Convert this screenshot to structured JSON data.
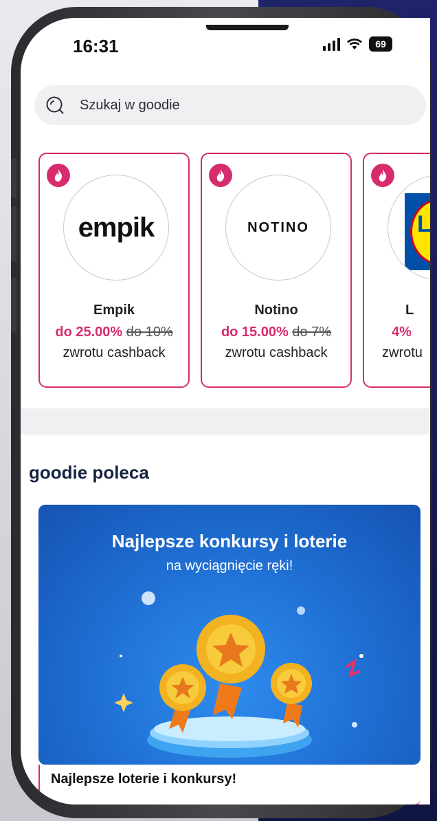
{
  "status_bar": {
    "time": "16:31",
    "battery": "69"
  },
  "search": {
    "placeholder": "Szukaj w goodie"
  },
  "shops": [
    {
      "name": "Empik",
      "logo_text": "empik",
      "rate": "do 25.00%",
      "old_rate": "do 10%",
      "suffix": "zwrotu cashback"
    },
    {
      "name": "Notino",
      "logo_text": "NOTINO",
      "rate": "do 15.00%",
      "old_rate": "do 7%",
      "suffix": "zwrotu cashback"
    },
    {
      "name": "L",
      "logo_text": "LI",
      "rate": "4%",
      "old_rate": "",
      "suffix": "zwrotu"
    }
  ],
  "section": {
    "title": "goodie poleca"
  },
  "banner": {
    "title": "Najlepsze konkursy i loterie",
    "subtitle": "na wyciągnięcie ręki!",
    "caption": "Najlepsze loterie i konkursy!"
  },
  "colors": {
    "accent": "#d62c6d",
    "banner_blue": "#1f6fd3",
    "title": "#16233f"
  }
}
